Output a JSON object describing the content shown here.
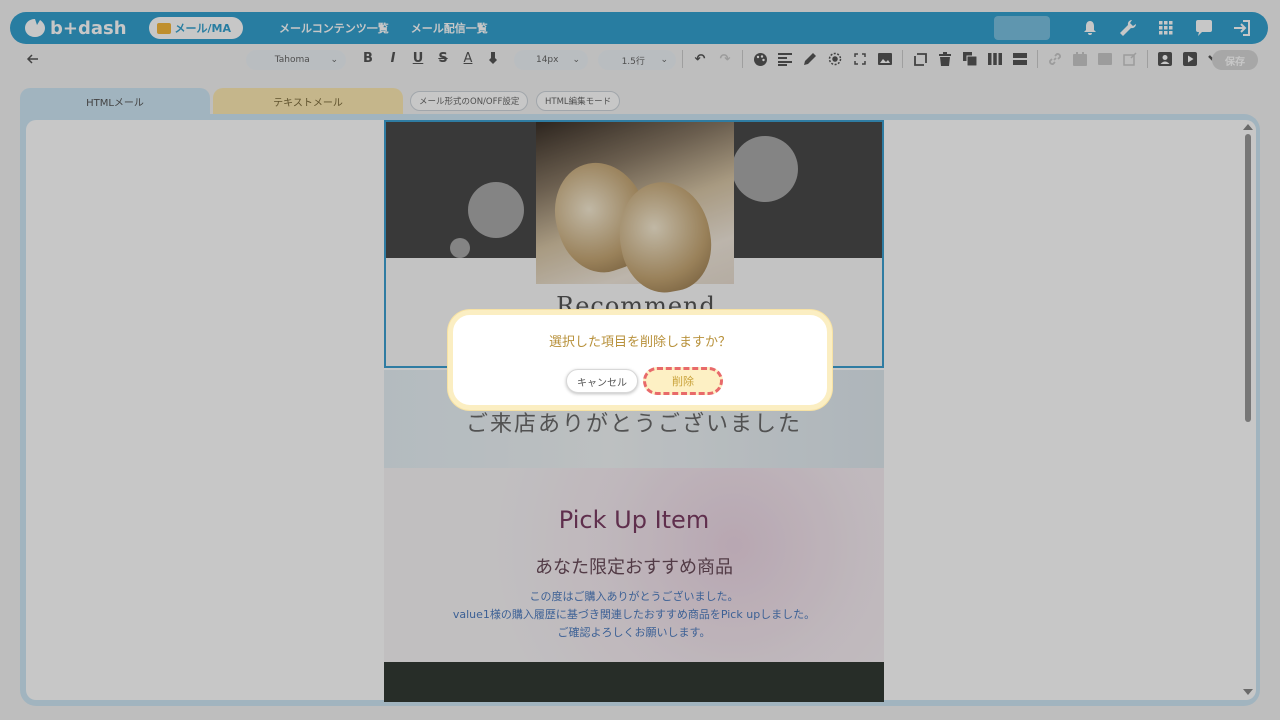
{
  "header": {
    "logo_text": "b+dash",
    "mode_label": "メール/MA",
    "nav": [
      "メールコンテンツ一覧",
      "メール配信一覧"
    ],
    "icons": [
      "bell-icon",
      "wrench-icon",
      "grid-icon",
      "chat-icon",
      "logout-icon"
    ]
  },
  "toolbar": {
    "font_family": "Tahoma",
    "font_size": "14px",
    "line_height": "1.5行",
    "format_buttons": [
      "B",
      "I",
      "U",
      "S",
      "A"
    ],
    "save_label": "保存"
  },
  "tabs": {
    "html": "HTMLメール",
    "text": "テキストメール"
  },
  "chips": {
    "onoff": "メール形式のON/OFF設定",
    "html_mode": "HTML編集モード"
  },
  "email": {
    "recommend": "Recommend",
    "thanks": "ご来店ありがとうございました",
    "pickup_title": "Pick Up Item",
    "pickup_sub": "あなた限定おすすめ商品",
    "pickup_lines": [
      "この度はご購入ありがとうございました。",
      "value1様の購入履歴に基づき関連したおすすめ商品をPick upしました。",
      "ご確認よろしくお願いします。"
    ]
  },
  "dialog": {
    "message": "選択した項目を削除しますか？",
    "cancel": "キャンセル",
    "delete": "削除"
  },
  "colors": {
    "brand": "#34a0cf",
    "dialog_text": "#b8913b",
    "delete_outline": "#e86a6a"
  }
}
